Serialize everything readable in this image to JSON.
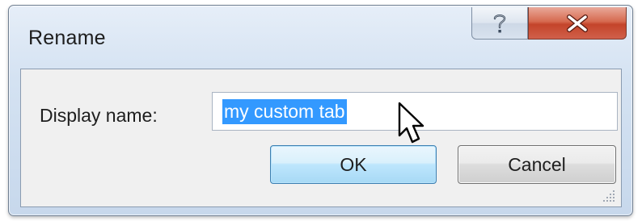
{
  "dialog": {
    "title": "Rename",
    "help_icon": "question-mark-icon",
    "close_icon": "close-x-icon",
    "close_color": "#c4442a"
  },
  "form": {
    "display_name_label": "Display name:",
    "display_name_value": "my custom tab",
    "value_selected": true,
    "selection_color": "#3399ff"
  },
  "buttons": {
    "ok_label": "OK",
    "cancel_label": "Cancel",
    "default_button": "OK"
  },
  "cursor": {
    "type": "arrow-pointer-icon",
    "hovering": "OK"
  }
}
